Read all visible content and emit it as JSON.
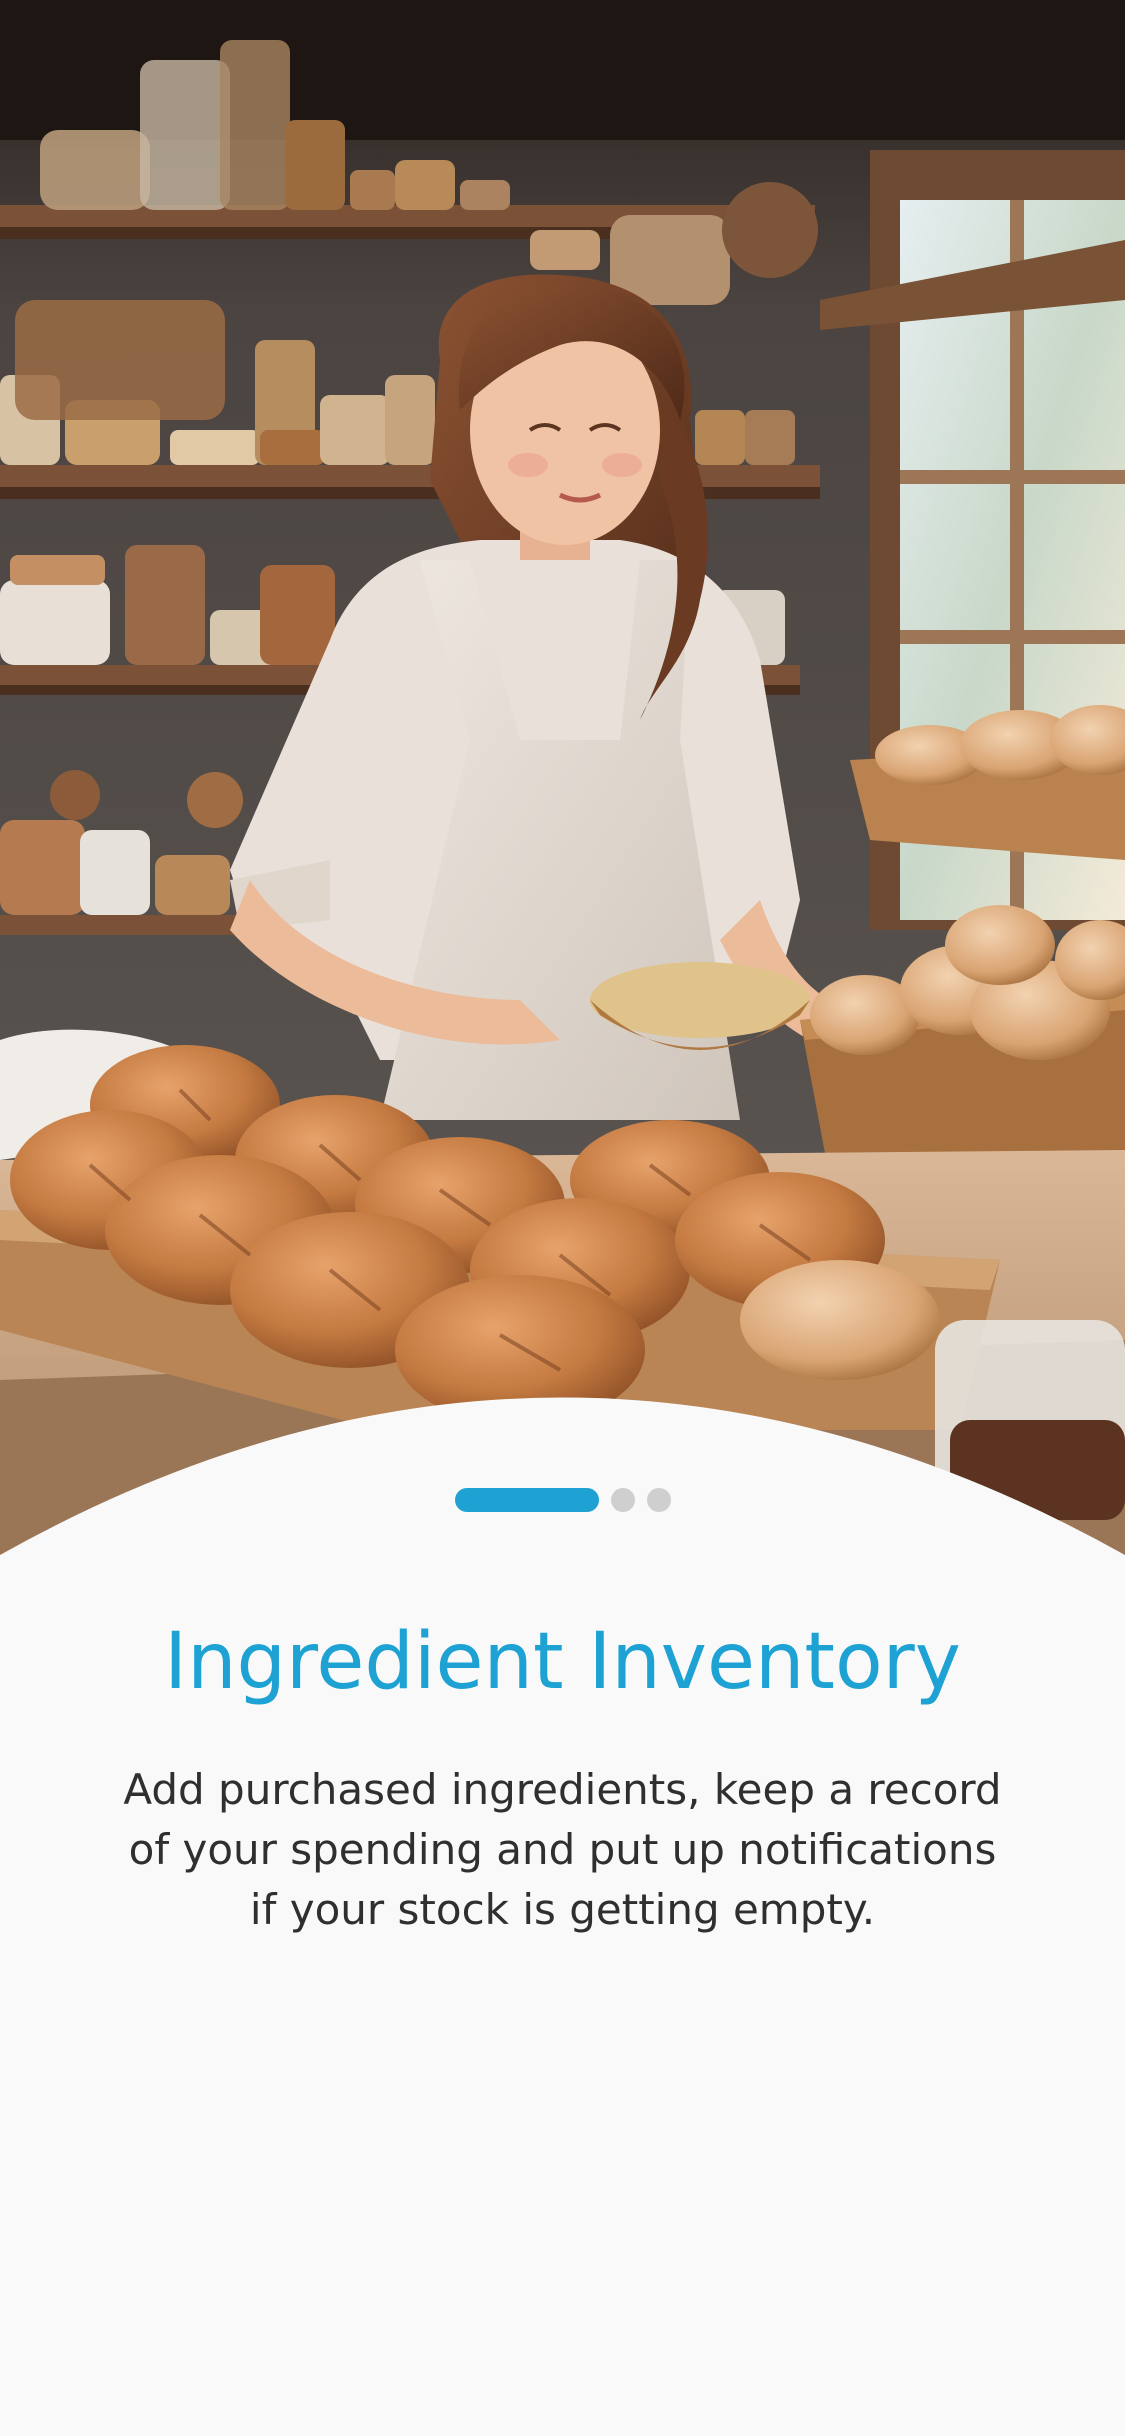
{
  "onboarding": {
    "hero_image": "baker-woman-with-bread-illustration",
    "pager": {
      "total_pages": 3,
      "current_page": 1
    },
    "title": "Ingredient Inventory",
    "description": "Add purchased ingredients, keep a record of your spending and put up notifications if your stock is getting empty."
  },
  "colors": {
    "accent": "#1da2d3",
    "inactive_dot": "#cfcfcf",
    "sheet_background": "#f9f9f9",
    "body_text": "#2f2f2f"
  }
}
